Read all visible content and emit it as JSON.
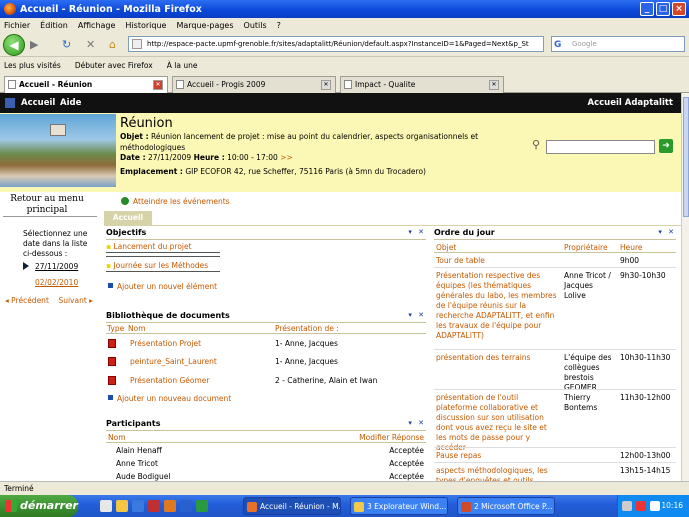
{
  "window": {
    "title": "Accueil - Réunion - Mozilla Firefox",
    "buttons": [
      "_",
      "□",
      "×"
    ]
  },
  "menu": [
    "Fichier",
    "Édition",
    "Affichage",
    "Historique",
    "Marque-pages",
    "Outils",
    "?"
  ],
  "nav": {
    "url": "http://espace-pacte.upmf-grenoble.fr/sites/adaptalitt/Réunion/default.aspx?InstanceID=1&Paged=Next&p_St",
    "search_placeholder": "Google"
  },
  "bookmarks": [
    "Les plus visités",
    "Débuter avec Firefox",
    "À la une"
  ],
  "browser_tabs": [
    {
      "label": "Accueil - Réunion",
      "active": true
    },
    {
      "label": "Accueil - Progis 2009",
      "active": false
    },
    {
      "label": "Impact - Qualite",
      "active": false
    }
  ],
  "site": {
    "nav_home": "Accueil",
    "nav_help": "Aide",
    "site_title": "Accueil Adaptalitt"
  },
  "meeting": {
    "title": "Réunion",
    "objet_label": "Objet :",
    "objet": "Réunion lancement de projet : mise au point du calendrier, aspects organisationnels et méthodologiques",
    "date_label": "Date :",
    "date": "27/11/2009",
    "heure_label": "Heure :",
    "heure": "10:00 - 17:00",
    "heure_more": ">>",
    "lieu_label": "Emplacement :",
    "lieu": "GIP ECOFOR 42, rue Scheffer, 75116 Paris (à 5mn du Trocadero)",
    "events_link": "Atteindre les événements"
  },
  "left": {
    "back": "Retour au menu principal",
    "select_text": "Sélectionnez une date dans la liste ci-dessous :",
    "dates": [
      "27/11/2009",
      "02/02/2010"
    ],
    "prev": "◂ Précédent",
    "next": "Suivant ▸"
  },
  "tab_label": "Accueil",
  "webpart_controls": "▾ ✕",
  "objectifs": {
    "title": "Objectifs",
    "items": [
      "Lancement du projet",
      "Journée sur les Méthodes"
    ],
    "add": "Ajouter un nouvel élément"
  },
  "bibliotheque": {
    "title": "Bibliothèque de documents",
    "cols": [
      "Type",
      "Nom",
      "Présentation de :"
    ],
    "rows": [
      {
        "name": "Présentation Projet",
        "by": "1- Anne, Jacques"
      },
      {
        "name": "peinture_Saint_Laurent",
        "by": "1- Anne, Jacques"
      },
      {
        "name": "Présentation Géomer",
        "by": "2 - Catherine, Alain et Iwan"
      }
    ],
    "add": "Ajouter un nouveau document"
  },
  "participants": {
    "title": "Participants",
    "cols": [
      "Nom",
      "Modifier Réponse"
    ],
    "rows": [
      {
        "name": "Alain Henaff",
        "status": "Acceptée"
      },
      {
        "name": "Anne Tricot",
        "status": "Acceptée"
      },
      {
        "name": "Aude Bodiguel",
        "status": "Acceptée"
      }
    ]
  },
  "ordre": {
    "title": "Ordre du jour",
    "cols": [
      "Objet",
      "Propriétaire",
      "Heure"
    ],
    "rows": [
      {
        "objet": "Tour de table",
        "owner": "",
        "heure": "9h00"
      },
      {
        "objet": "Présentation respective des équipes (les thématiques générales du labo, les membres de l'équipe réunis sur la recherche ADAPTALITT, et enfin les travaux de l'équipe pour ADAPTALITT)",
        "owner": "Anne Tricot / Jacques Lolive",
        "heure": "9h30-10h30"
      },
      {
        "objet": "présentation des terrains",
        "owner": "L'équipe des collègues brestois GEOMER",
        "heure": "10h30-11h30"
      },
      {
        "objet": "présentation de l'outil plateforme collaborative et discussion sur son utilisation dont vous avez reçu le site et les mots de passe pour y accéder",
        "owner": "Thierry Bontems",
        "heure": "11h30-12h00"
      },
      {
        "objet": "Pause repas",
        "owner": "",
        "heure": "12h00-13h00"
      },
      {
        "objet": "aspects méthodologiques, les types d'enquêtes et outils",
        "owner": "",
        "heure": "13h15-14h15"
      }
    ]
  },
  "status_text": "Terminé",
  "taskbar": {
    "start": "démarrer",
    "tasks": [
      "Accueil - Réunion - M...",
      "3 Explorateur Wind...",
      "2 Microsoft Office P..."
    ],
    "clock": "10:16"
  }
}
